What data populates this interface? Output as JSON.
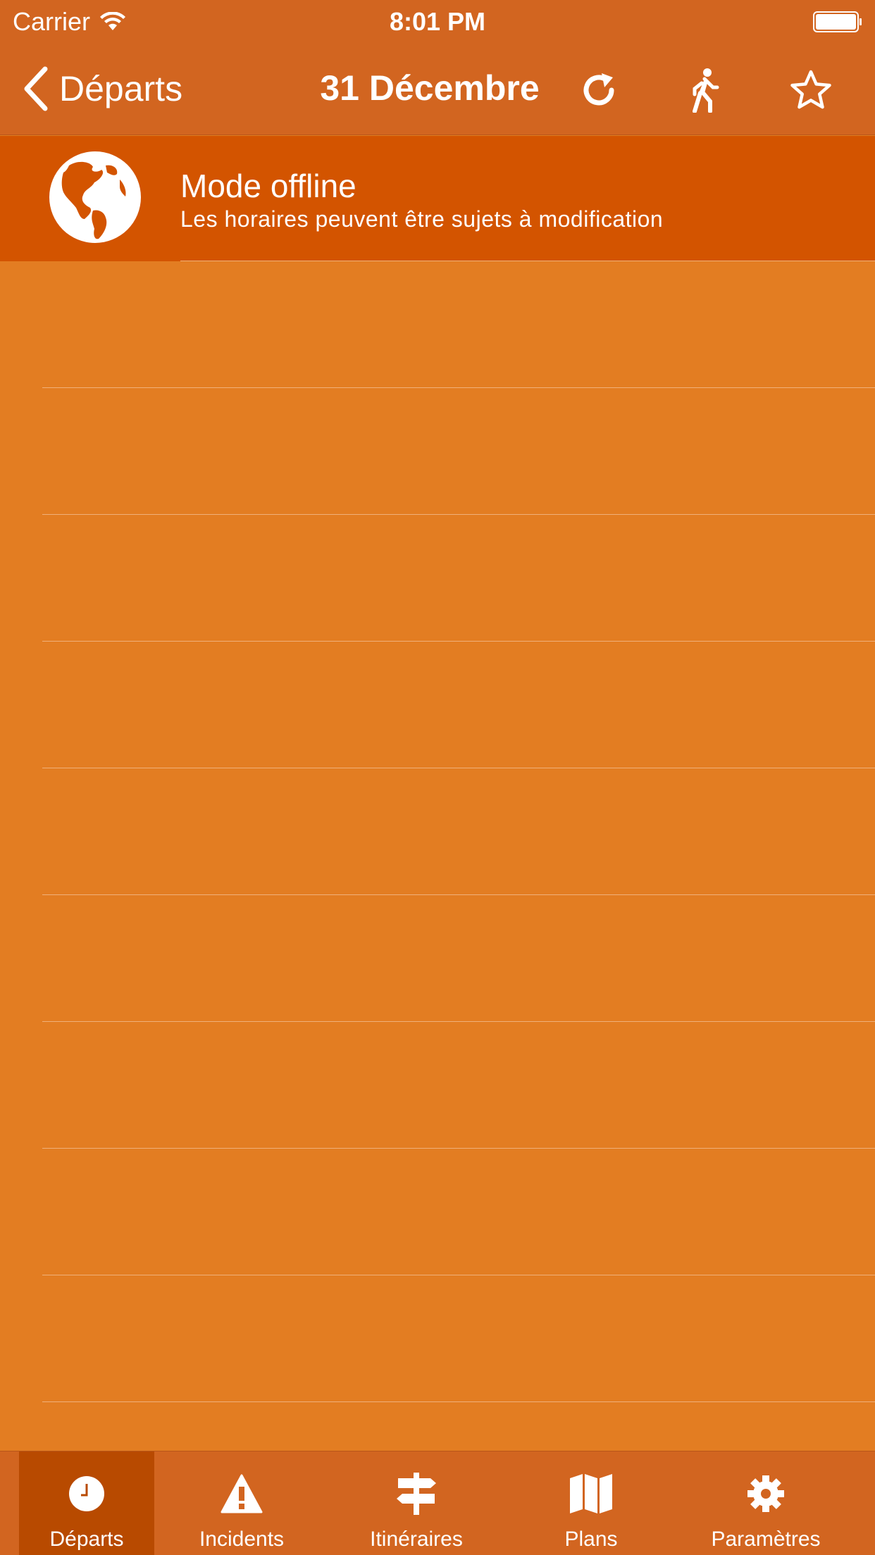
{
  "status_bar": {
    "carrier": "Carrier",
    "time": "8:01 PM"
  },
  "nav": {
    "back_label": "Départs",
    "title": "31 Décembre",
    "icons": [
      "refresh-icon",
      "walking-icon",
      "star-icon"
    ]
  },
  "offline_banner": {
    "title": "Mode offline",
    "subtitle": "Les horaires peuvent être sujets à modification"
  },
  "tabs": [
    {
      "label": "Départs",
      "icon": "clock-icon",
      "selected": true
    },
    {
      "label": "Incidents",
      "icon": "warning-icon",
      "selected": false
    },
    {
      "label": "Itinéraires",
      "icon": "signpost-icon",
      "selected": false
    },
    {
      "label": "Plans",
      "icon": "map-icon",
      "selected": false
    },
    {
      "label": "Paramètres",
      "icon": "gear-icon",
      "selected": false
    }
  ],
  "colors": {
    "background": "#E37D22",
    "nav_bar": "#D26520",
    "banner": "#D35400",
    "tab_selected": "#B84A00"
  }
}
